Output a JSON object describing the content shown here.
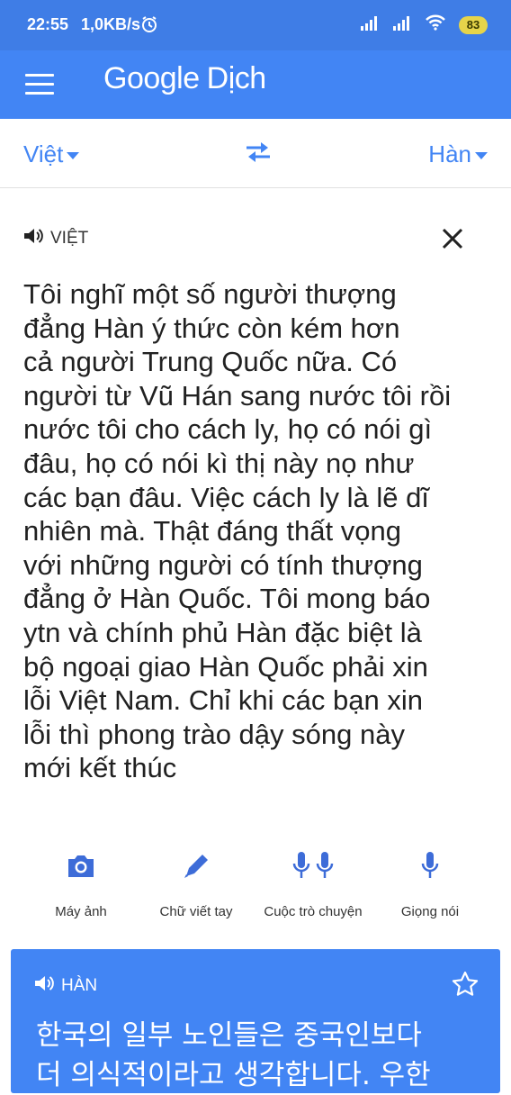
{
  "status_bar": {
    "time": "22:55",
    "speed": "1,0KB/s",
    "battery": "83"
  },
  "app_bar": {
    "logo_google": "Google",
    "logo_dich": "Dịch"
  },
  "languages": {
    "source": "Việt",
    "target": "Hàn"
  },
  "source_card": {
    "language_label": "VIỆT",
    "lines": [
      "Tôi nghĩ một số người thượng",
      "đẳng Hàn ý thức còn kém hơn",
      "cả người Trung Quốc nữa. Có",
      "người từ Vũ Hán sang nước tôi rồi",
      "nước tôi cho cách ly, họ có nói gì",
      "đâu, họ có nói kì thị này nọ như",
      "các bạn đâu. Việc cách ly là lẽ dĩ",
      "nhiên mà. Thật đáng thất vọng",
      "với những người có tính thượng",
      "đẳng ở Hàn Quốc. Tôi mong báo",
      "ytn và chính phủ Hàn đặc biệt là",
      "bộ ngoại giao Hàn Quốc phải xin",
      "lỗi Việt Nam. Chỉ khi các bạn xin",
      "lỗi thì phong trào dậy sóng này",
      "mới kết thúc"
    ]
  },
  "tools": {
    "camera": "Máy ảnh",
    "handwriting": "Chữ viết tay",
    "conversation": "Cuộc trò chuyện",
    "voice": "Giọng nói"
  },
  "translation_card": {
    "language_label": "HÀN",
    "lines": [
      "한국의 일부 노인들은 중국인보다",
      "더 의식적이라고 생각합니다. 우한"
    ]
  },
  "colors": {
    "brand_blue": "#4285f4",
    "status_blue": "#3f7de6",
    "tool_icon_blue": "#3d6cd8"
  }
}
